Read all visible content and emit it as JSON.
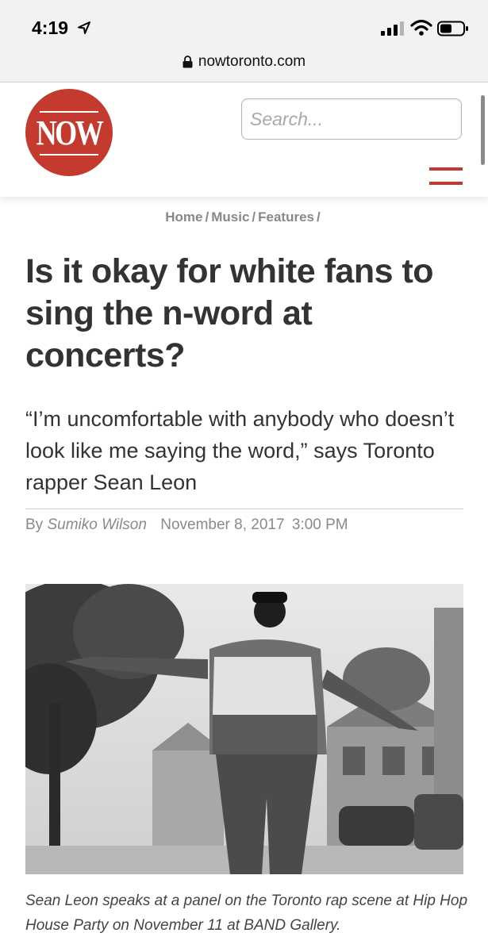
{
  "status_bar": {
    "time": "4:19"
  },
  "browser": {
    "url": "nowtoronto.com"
  },
  "header": {
    "logo_text": "NOW",
    "search_placeholder": "Search...",
    "accent_color": "#c43a2f"
  },
  "breadcrumb": [
    {
      "label": "Home"
    },
    {
      "label": "Music"
    },
    {
      "label": "Features"
    }
  ],
  "article": {
    "headline": "Is it okay for white fans to sing the n-word at concerts?",
    "dek": "“I’m uncomfortable with anybody who doesn’t look like me saying the word,” says Toronto rapper Sean Leon",
    "byline_prefix": "By",
    "author": "Sumiko Wilson",
    "date": "November 8, 2017",
    "time": "3:00 PM",
    "photo_caption": "Sean Leon speaks at a panel on the Toronto rap scene at Hip Hop House Party on November 11 at BAND Gallery."
  },
  "icons": [
    "location-arrow-icon",
    "signal-icon",
    "wifi-icon",
    "battery-icon",
    "lock-icon",
    "hamburger-menu-icon"
  ]
}
